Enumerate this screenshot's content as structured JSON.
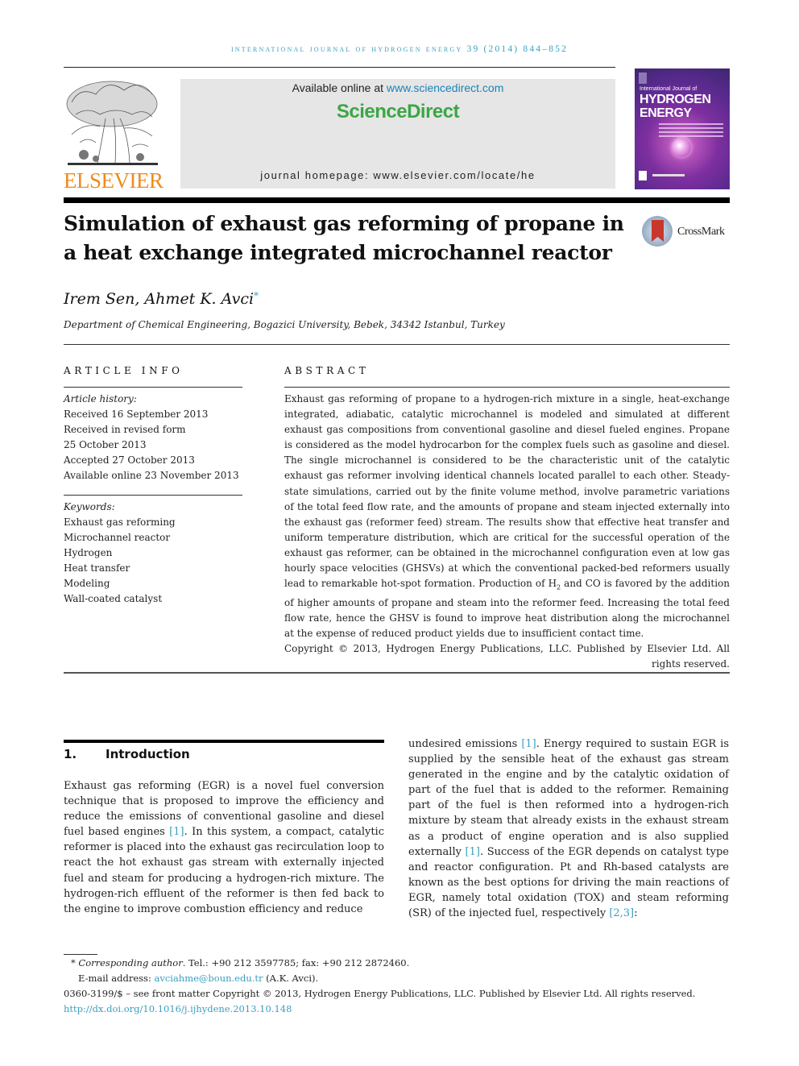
{
  "running_head": "International Journal of Hydrogen Energy 39 (2014) 844–852",
  "header": {
    "publisher_logo_text": "ELSEVIER",
    "available_prefix": "Available online at ",
    "available_link": "www.sciencedirect.com",
    "brand": "ScienceDirect",
    "homepage": "journal homepage: www.elsevier.com/locate/he",
    "cover": {
      "line1": "International Journal of",
      "line2": "HYDROGEN",
      "line3": "ENERGY"
    }
  },
  "article": {
    "title": "Simulation of exhaust gas reforming of propane in a heat exchange integrated microchannel reactor",
    "crossmark_label": "CrossMark",
    "authors": "Irem Sen, Ahmet K. Avci",
    "corresponding_mark": "*",
    "affiliation": "Department of Chemical Engineering, Bogazici University, Bebek, 34342 Istanbul, Turkey"
  },
  "article_info": {
    "heading": "ARTICLE INFO",
    "history_label": "Article history:",
    "history": [
      "Received 16 September 2013",
      "Received in revised form",
      "25 October 2013",
      "Accepted 27 October 2013",
      "Available online 23 November 2013"
    ],
    "keywords_label": "Keywords:",
    "keywords": [
      "Exhaust gas reforming",
      "Microchannel reactor",
      "Hydrogen",
      "Heat transfer",
      "Modeling",
      "Wall-coated catalyst"
    ]
  },
  "abstract": {
    "heading": "ABSTRACT",
    "text_before_sub": "Exhaust gas reforming of propane to a hydrogen-rich mixture in a single, heat-exchange integrated, adiabatic, catalytic microchannel is modeled and simulated at different exhaust gas compositions from conventional gasoline and diesel fueled engines. Propane is considered as the model hydrocarbon for the complex fuels such as gasoline and diesel. The single microchannel is considered to be the characteristic unit of the catalytic exhaust gas reformer involving identical channels located parallel to each other. Steady-state simulations, carried out by the finite volume method, involve parametric variations of the total feed flow rate, and the amounts of propane and steam injected externally into the exhaust gas (reformer feed) stream. The results show that effective heat transfer and uniform temperature distribution, which are critical for the successful operation of the exhaust gas reformer, can be obtained in the microchannel configuration even at low gas hourly space velocities (GHSVs) at which the conventional packed-bed reformers usually lead to remarkable hot-spot formation. Production of H",
    "subscript": "2",
    "text_after_sub": " and CO is favored by the addition of higher amounts of propane and steam into the reformer feed. Increasing the total feed flow rate, hence the GHSV is found to improve heat distribution along the microchannel at the expense of reduced product yields due to insufficient contact time.",
    "copyright": "Copyright © 2013, Hydrogen Energy Publications, LLC. Published by Elsevier Ltd. All rights reserved."
  },
  "section1": {
    "number": "1.",
    "title": "Introduction",
    "left_col": [
      {
        "t": "Exhaust gas reforming (EGR) is a novel fuel conversion technique that is proposed to improve the efficiency and reduce the emissions of conventional gasoline and diesel fuel based engines "
      },
      {
        "ref": "[1]"
      },
      {
        "t": ". In this system, a compact, catalytic reformer is placed into the exhaust gas recirculation loop to react the hot exhaust gas stream with externally injected fuel and steam for producing a hydrogen-rich mixture. The hydrogen-rich effluent of the reformer is then fed back to the engine to improve combustion efficiency and reduce"
      }
    ],
    "right_col": [
      {
        "t": "undesired emissions "
      },
      {
        "ref": "[1]"
      },
      {
        "t": ". Energy required to sustain EGR is supplied by the sensible heat of the exhaust gas stream generated in the engine and by the catalytic oxidation of part of the fuel that is added to the reformer. Remaining part of the fuel is then reformed into a hydrogen-rich mixture by steam that already exists in the exhaust stream as a product of engine operation and is also supplied externally "
      },
      {
        "ref": "[1]"
      },
      {
        "t": ". Success of the EGR depends on catalyst type and reactor configuration. Pt and Rh-based catalysts are known as the best options for driving the main reactions of EGR, namely total oxidation (TOX) and steam reforming (SR) of the injected fuel, respectively "
      },
      {
        "ref": "[2,3]"
      },
      {
        "t": ":"
      }
    ]
  },
  "footnotes": {
    "star": "*",
    "corresponding_label": "Corresponding author",
    "contact": ". Tel.: +90 212 3597785; fax: +90 212 2872460.",
    "email_label": "E-mail address: ",
    "email": "avciahme@boun.edu.tr",
    "email_suffix": " (A.K. Avci).",
    "issn_line": "0360-3199/$ – see front matter Copyright © 2013, Hydrogen Energy Publications, LLC. Published by Elsevier Ltd. All rights reserved.",
    "doi": "http://dx.doi.org/10.1016/j.ijhydene.2013.10.148"
  },
  "colors": {
    "link": "#3a9fbf",
    "elsevier_orange": "#f08a1e",
    "sciencedirect_green": "#3ba646",
    "header_box_bg": "#e6e6e6"
  }
}
